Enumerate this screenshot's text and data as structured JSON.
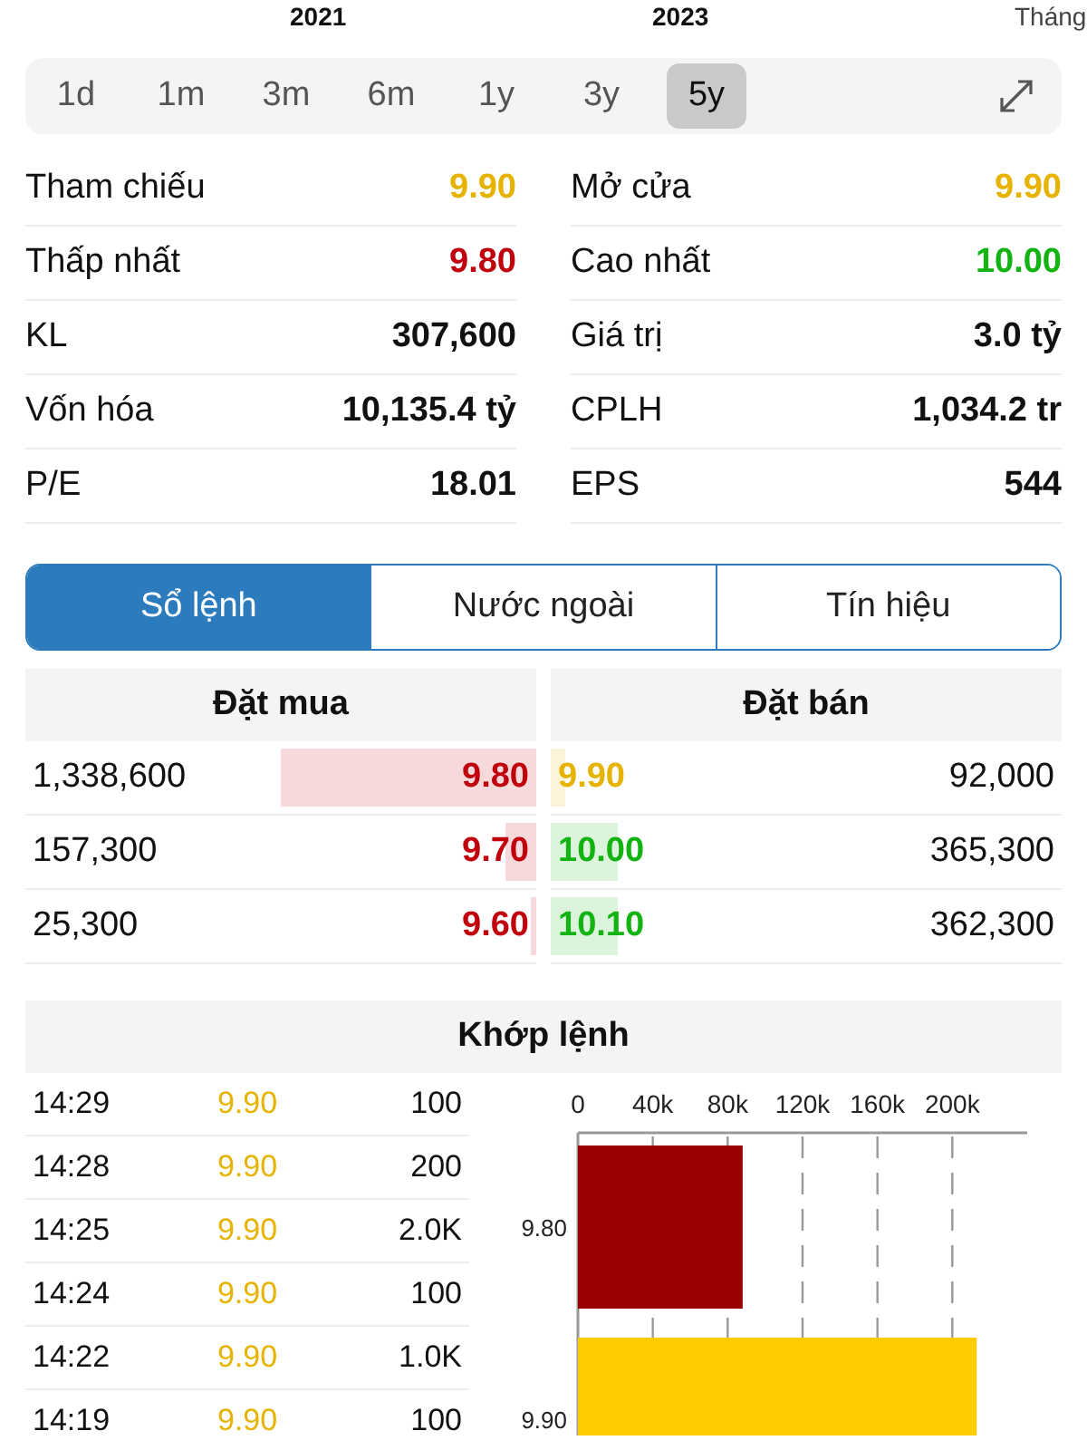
{
  "axis_labels": [
    "2021",
    "2023",
    "Tháng"
  ],
  "timeframes": [
    {
      "label": "1d",
      "selected": false
    },
    {
      "label": "1m",
      "selected": false
    },
    {
      "label": "3m",
      "selected": false
    },
    {
      "label": "6m",
      "selected": false
    },
    {
      "label": "1y",
      "selected": false
    },
    {
      "label": "3y",
      "selected": false
    },
    {
      "label": "5y",
      "selected": true
    }
  ],
  "stats": [
    {
      "label": "Tham chiếu",
      "value": "9.90",
      "color": "#e6b400"
    },
    {
      "label": "Mở cửa",
      "value": "9.90",
      "color": "#e6b400"
    },
    {
      "label": "Thấp nhất",
      "value": "9.80",
      "color": "#c0000c"
    },
    {
      "label": "Cao nhất",
      "value": "10.00",
      "color": "#12b312"
    },
    {
      "label": "KL",
      "value": "307,600",
      "color": "#111111"
    },
    {
      "label": "Giá trị",
      "value": "3.0 tỷ",
      "color": "#111111"
    },
    {
      "label": "Vốn hóa",
      "value": "10,135.4 tỷ",
      "color": "#111111"
    },
    {
      "label": "CPLH",
      "value": "1,034.2 tr",
      "color": "#111111"
    },
    {
      "label": "P/E",
      "value": "18.01",
      "color": "#111111"
    },
    {
      "label": "EPS",
      "value": "544",
      "color": "#111111"
    }
  ],
  "tabs": [
    {
      "label": "Sổ lệnh",
      "selected": true
    },
    {
      "label": "Nước ngoài",
      "selected": false
    },
    {
      "label": "Tín hiệu",
      "selected": false
    }
  ],
  "order_book": {
    "bid_title": "Đặt mua",
    "ask_title": "Đặt bán",
    "rows": [
      {
        "bid": {
          "volume": "1,338,600",
          "price": "9.80",
          "color": "#c0000c",
          "level": 0.5
        },
        "ask": {
          "price": "9.90",
          "color": "#e6b400",
          "level": 0.03,
          "volume": "92,000"
        }
      },
      {
        "bid": {
          "volume": "157,300",
          "price": "9.70",
          "color": "#c0000c",
          "level": 0.06
        },
        "ask": {
          "price": "10.00",
          "color": "#12b312",
          "level": 0.13,
          "volume": "365,300"
        }
      },
      {
        "bid": {
          "volume": "25,300",
          "price": "9.60",
          "color": "#c0000c",
          "level": 0.01
        },
        "ask": {
          "price": "10.10",
          "color": "#12b312",
          "level": 0.13,
          "volume": "362,300"
        }
      }
    ]
  },
  "matched": {
    "title": "Khớp lệnh",
    "trades": [
      {
        "time": "14:29",
        "price": "9.90",
        "color": "#e6b400",
        "volume": "100"
      },
      {
        "time": "14:28",
        "price": "9.90",
        "color": "#e6b400",
        "volume": "200"
      },
      {
        "time": "14:25",
        "price": "9.90",
        "color": "#e6b400",
        "volume": "2.0K"
      },
      {
        "time": "14:24",
        "price": "9.90",
        "color": "#e6b400",
        "volume": "100"
      },
      {
        "time": "14:22",
        "price": "9.90",
        "color": "#e6b400",
        "volume": "1.0K"
      },
      {
        "time": "14:19",
        "price": "9.90",
        "color": "#e6b400",
        "volume": "100"
      }
    ],
    "chart_data": {
      "type": "bar",
      "orientation": "horizontal",
      "grid": true,
      "categories": [
        "9.80",
        "9.90"
      ],
      "series": [
        {
          "color": "#990000",
          "values": [
            88000,
            null
          ]
        },
        {
          "color": "#ffcc00",
          "values": [
            null,
            213000
          ]
        }
      ],
      "xlim": [
        0,
        240000
      ],
      "xticks": [
        {
          "value": 0,
          "label": "0"
        },
        {
          "value": 40000,
          "label": "40k"
        },
        {
          "value": 80000,
          "label": "80k"
        },
        {
          "value": 120000,
          "label": "120k"
        },
        {
          "value": 160000,
          "label": "160k"
        },
        {
          "value": 200000,
          "label": "200k"
        }
      ]
    }
  }
}
